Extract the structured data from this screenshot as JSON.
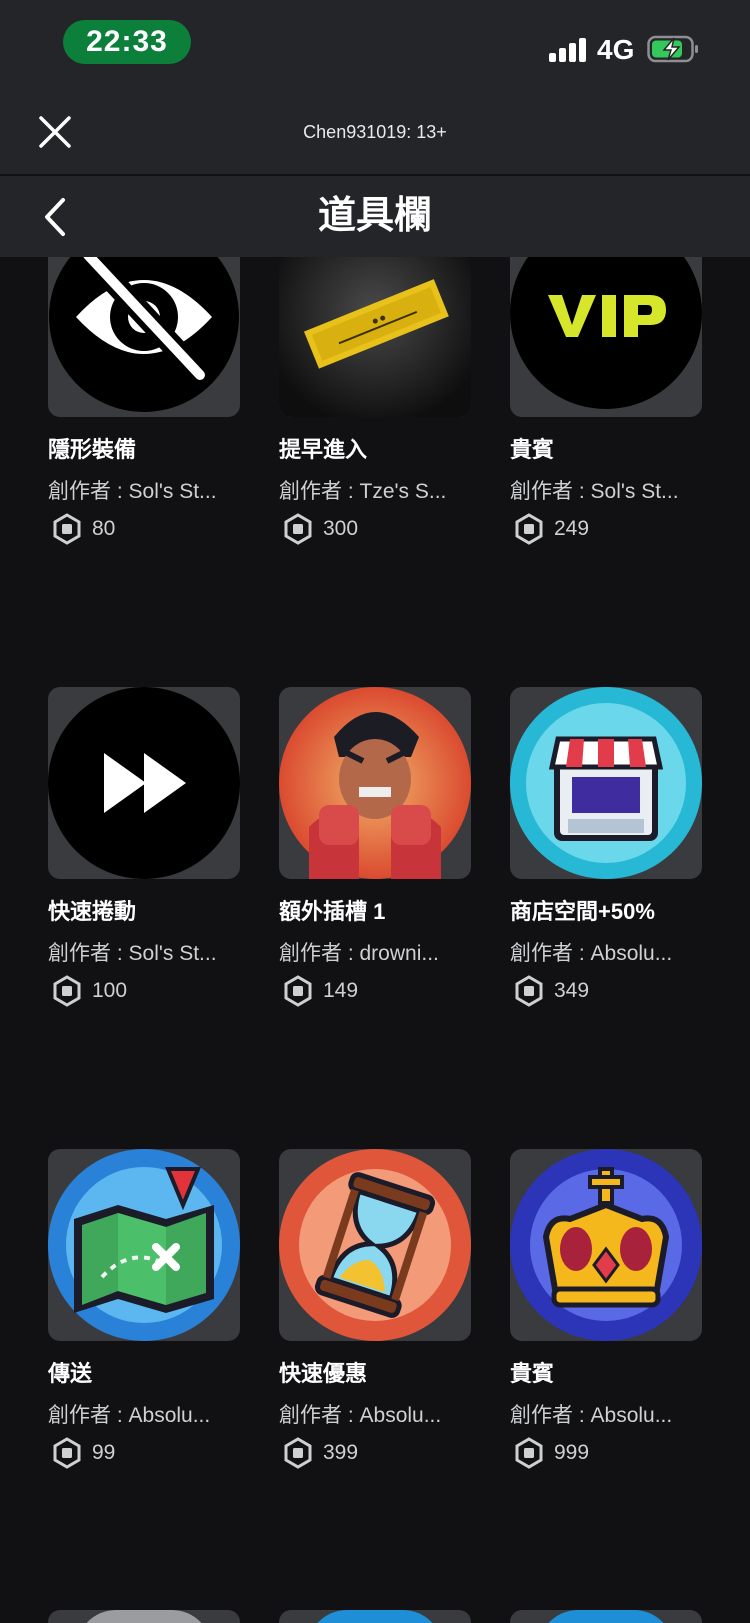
{
  "status_bar": {
    "time": "22:33",
    "network": "4G"
  },
  "header": {
    "account_label": "Chen931019: 13+",
    "page_title": "道具欄"
  },
  "items": [
    {
      "name": "隱形裝備",
      "creator": "創作者 : Sol's St...",
      "price": "80",
      "icon": "hidden-eye-icon"
    },
    {
      "name": "提早進入",
      "creator": "創作者 : Tze's S...",
      "price": "300",
      "icon": "gold-ticket-icon"
    },
    {
      "name": "貴賓",
      "creator": "創作者 : Sol's St...",
      "price": "249",
      "icon": "vip-icon"
    },
    {
      "name": "快速捲動",
      "creator": "創作者 : Sol's St...",
      "price": "100",
      "icon": "fast-forward-icon"
    },
    {
      "name": "額外插槽 1",
      "creator": "創作者 : drowni...",
      "price": "149",
      "icon": "fighter-portrait-icon"
    },
    {
      "name": "商店空間+50%",
      "creator": "創作者 : Absolu...",
      "price": "349",
      "icon": "storefront-icon"
    },
    {
      "name": "傳送",
      "creator": "創作者 : Absolu...",
      "price": "99",
      "icon": "map-icon"
    },
    {
      "name": "快速優惠",
      "creator": "創作者 : Absolu...",
      "price": "399",
      "icon": "hourglass-icon"
    },
    {
      "name": "貴賓",
      "creator": "創作者 : Absolu...",
      "price": "999",
      "icon": "crown-icon"
    }
  ],
  "colors": {
    "background": "#111114",
    "header": "#242528",
    "card": "#393b3f",
    "time_pill": "#0c7f3a",
    "battery": "#34c759"
  }
}
